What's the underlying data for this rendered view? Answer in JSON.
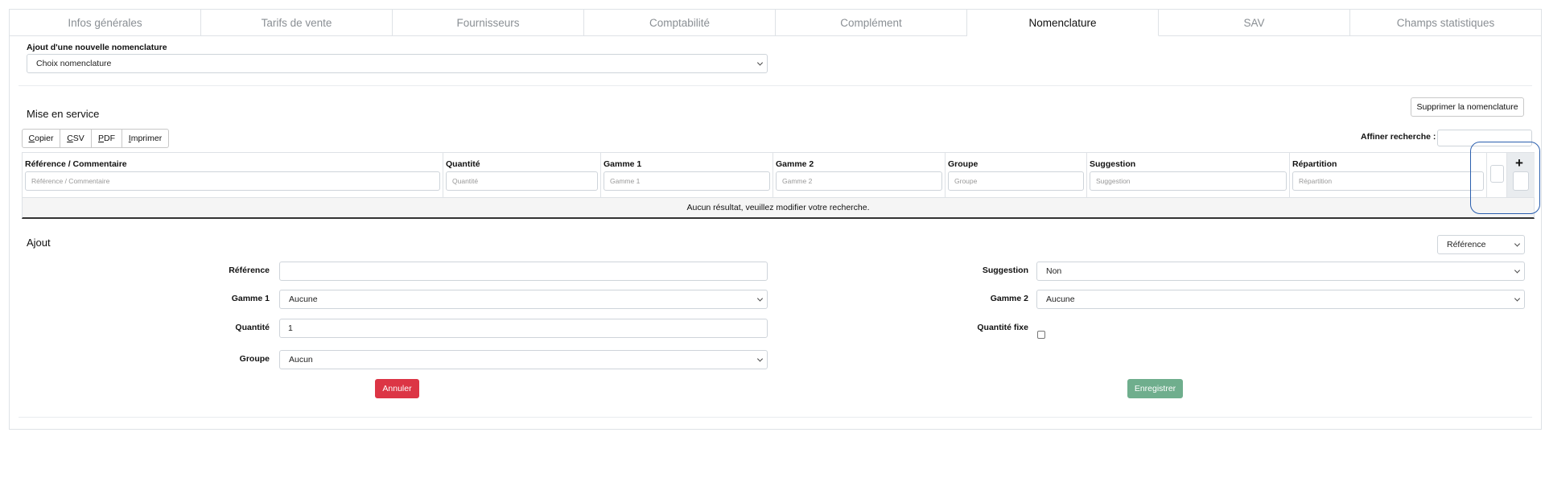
{
  "tabs": [
    "Infos générales",
    "Tarifs de vente",
    "Fournisseurs",
    "Comptabilité",
    "Complément",
    "Nomenclature",
    "SAV",
    "Champs statistiques"
  ],
  "active_tab_index": 5,
  "add_nomenclature": {
    "label": "Ajout d'une nouvelle nomenclature",
    "select_value": "Choix nomenclature"
  },
  "service": {
    "title": "Mise en service",
    "delete_button": "Supprimer la nomenclature",
    "export_buttons": {
      "copy": {
        "u": "C",
        "rest": "opier"
      },
      "csv": {
        "u": "C",
        "rest": "SV"
      },
      "pdf": {
        "u": "P",
        "rest": "DF"
      },
      "print": {
        "u": "I",
        "rest": "mprimer"
      }
    },
    "filter_label": "Affiner recherche :",
    "filter_value": "",
    "columns": [
      {
        "title": "Référence / Commentaire",
        "placeholder": "Référence / Commentaire"
      },
      {
        "title": "Quantité",
        "placeholder": "Quantité"
      },
      {
        "title": "Gamme 1",
        "placeholder": "Gamme 1"
      },
      {
        "title": "Gamme 2",
        "placeholder": "Gamme 2"
      },
      {
        "title": "Groupe",
        "placeholder": "Groupe"
      },
      {
        "title": "Suggestion",
        "placeholder": "Suggestion"
      },
      {
        "title": "Répartition",
        "placeholder": "Répartition"
      }
    ],
    "plus_icon": "+",
    "empty_message": "Aucun résultat, veuillez modifier votre recherche."
  },
  "ajout": {
    "title": "Ajout",
    "type_select": "Référence",
    "fields": {
      "reference": {
        "label": "Référence",
        "value": ""
      },
      "gamme1": {
        "label": "Gamme 1",
        "value": "Aucune"
      },
      "quantite": {
        "label": "Quantité",
        "value": "1"
      },
      "groupe": {
        "label": "Groupe",
        "value": "Aucun"
      },
      "suggestion": {
        "label": "Suggestion",
        "value": "Non"
      },
      "gamme2": {
        "label": "Gamme 2",
        "value": "Aucune"
      },
      "quantite_fixe": {
        "label": "Quantité fixe",
        "checked": false
      }
    },
    "cancel_button": "Annuler",
    "save_button": "Enregistrer"
  },
  "colors": {
    "cancel": "#dc3545",
    "save": "#6fae8d",
    "highlight": "#2b5fae"
  }
}
